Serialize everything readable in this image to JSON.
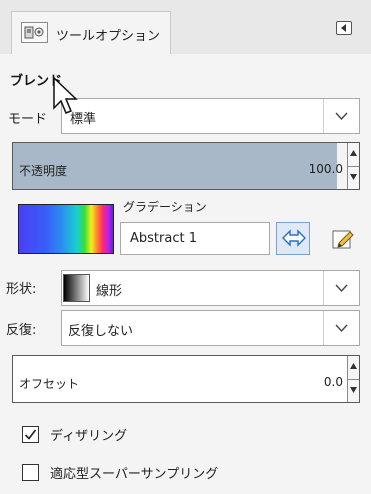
{
  "tab": {
    "label": "ツールオプション"
  },
  "section": {
    "title": "ブレンド"
  },
  "mode": {
    "label": "モード",
    "value": "標準"
  },
  "opacity": {
    "label": "不透明度",
    "value": "100.0"
  },
  "gradient": {
    "label": "グラデーション",
    "name": "Abstract 1"
  },
  "shape": {
    "label": "形状:",
    "value": "線形"
  },
  "repeat": {
    "label": "反復:",
    "value": "反復しない"
  },
  "offset": {
    "label": "オフセット",
    "value": "0.0"
  },
  "options": {
    "dithering": {
      "label": "ディザリング",
      "checked": true
    },
    "adaptive": {
      "label": "適応型スーパーサンプリング",
      "checked": false
    }
  },
  "icons": {
    "tab": "tool-options-icon",
    "menu": "tab-menu-icon",
    "reverse": "reverse-gradient-icon",
    "edit": "edit-gradient-icon",
    "cursor": "mouse-pointer-icon"
  },
  "colors": {
    "opacity_fill": "#a8b8c8",
    "panel_bg": "#f4f4f4",
    "accent": "#2a6fc8"
  }
}
